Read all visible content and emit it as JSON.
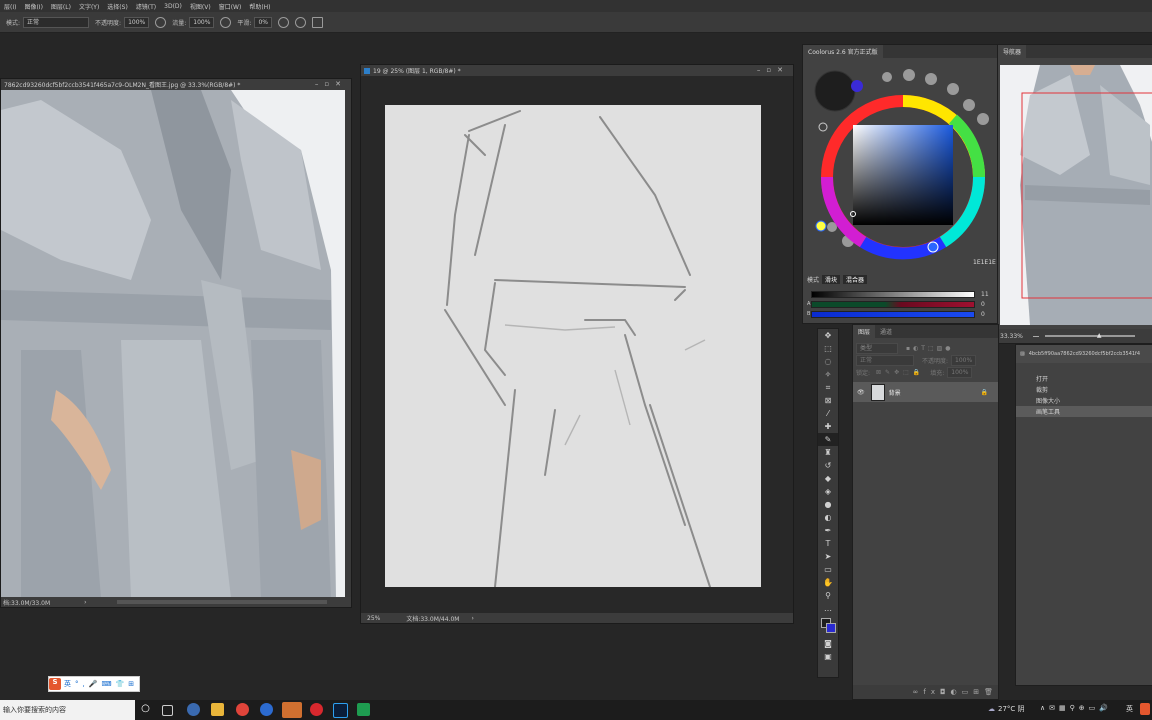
{
  "menu": [
    "层(I)",
    "图像(I)",
    "图层(L)",
    "文字(Y)",
    "选择(S)",
    "滤镜(T)",
    "3D(D)",
    "视图(V)",
    "窗口(W)",
    "帮助(H)"
  ],
  "options": {
    "mode_label": "模式:",
    "mode_value": "正常",
    "opacity_label": "不透明度:",
    "opacity_value": "100%",
    "flow_label": "流量:",
    "flow_value": "100%",
    "smooth_label": "平滑:",
    "smooth_value": "0%"
  },
  "doc1": {
    "title": "7862cd93260dcf5bf2ccb3541f465a7c9-OLM2N_看图王.jpg @ 33.3%(RGB/8#) *",
    "status": "档:33.0M/33.0M"
  },
  "doc2": {
    "title": "19 @ 25% (图层 1, RGB/8#) *",
    "zoom": "25%",
    "status": "文档:33.0M/44.0M"
  },
  "coolorus": {
    "title": "Coolorus 2.6 官方正式版",
    "hex": "1E1E1E",
    "tabs": [
      "模式",
      "滑块",
      "混合器"
    ],
    "slider_labels": [
      "",
      "A",
      "B"
    ],
    "slider_values": [
      "11",
      "0",
      "0"
    ]
  },
  "navigator": {
    "tab": "导航器",
    "zoom": "33.33%"
  },
  "layers": {
    "tabs": [
      "图层",
      "通道"
    ],
    "kind": "类型",
    "blend": "正常",
    "opacity_label": "不透明度:",
    "opacity_value": "100%",
    "lock_label": "锁定:",
    "fill_label": "填充:",
    "fill_value": "100%",
    "layer_name": "背景"
  },
  "history": {
    "doc": "4bcb5ff90aa7862cd93260dcf5bf2ccb3541f4",
    "items": [
      "打开",
      "裁剪",
      "图像大小",
      "画笔工具"
    ]
  },
  "ime": {
    "label": "英"
  },
  "taskbar": {
    "search": "输入你要搜索的内容",
    "weather": "27°C 阴",
    "lang": "英"
  },
  "colors": {
    "accent": "#2f6fd6",
    "fg": "#1e1e1e",
    "bg": "#2a2ad0"
  }
}
